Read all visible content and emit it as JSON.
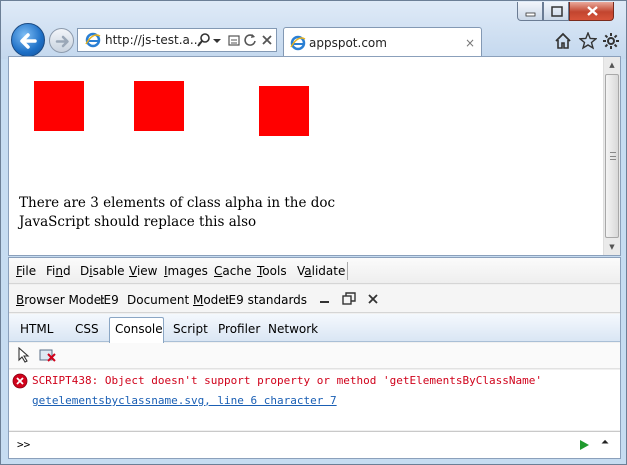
{
  "browser": {
    "address_url": "http://js-test.a...",
    "tab_title": "appspot.com",
    "tab_close": "×",
    "icons": [
      "back-arrow-icon",
      "forward-arrow-icon",
      "ie-logo-icon",
      "search-icon",
      "compat-view-icon",
      "refresh-icon",
      "stop-icon",
      "home-icon",
      "favorites-star-icon",
      "gear-icon"
    ]
  },
  "page": {
    "line1": "There are 3 elements of class alpha in the doc",
    "line2": "JavaScript should replace this also",
    "square_color": "#ff0000"
  },
  "devtools": {
    "menu": [
      {
        "pre": "",
        "key": "F",
        "post": "ile"
      },
      {
        "pre": "Fi",
        "key": "n",
        "post": "d"
      },
      {
        "pre": "D",
        "key": "i",
        "post": "sable"
      },
      {
        "pre": "",
        "key": "V",
        "post": "iew"
      },
      {
        "pre": "",
        "key": "I",
        "post": "mages"
      },
      {
        "pre": "",
        "key": "C",
        "post": "ache"
      },
      {
        "pre": "",
        "key": "T",
        "post": "ools"
      },
      {
        "pre": "V",
        "key": "a",
        "post": "lidate"
      }
    ],
    "browser_mode": {
      "pre": "",
      "key": "B",
      "post": "rowser Mode:",
      "value": "IE9"
    },
    "document_mode": {
      "pre": "Document ",
      "key": "M",
      "post": "ode:",
      "value": "IE9 standards"
    },
    "tabs": [
      "HTML",
      "CSS",
      "Console",
      "Script",
      "Profiler",
      "Network"
    ],
    "active_tab": "Console",
    "console": {
      "error_message": "SCRIPT438: Object doesn't support property or method 'getElementsByClassName'",
      "error_location": "getelementsbyclassname.svg, line 6 character 7",
      "prompt": ">>"
    },
    "error_color": "#d0021b",
    "link_color": "#1a5fb4"
  }
}
